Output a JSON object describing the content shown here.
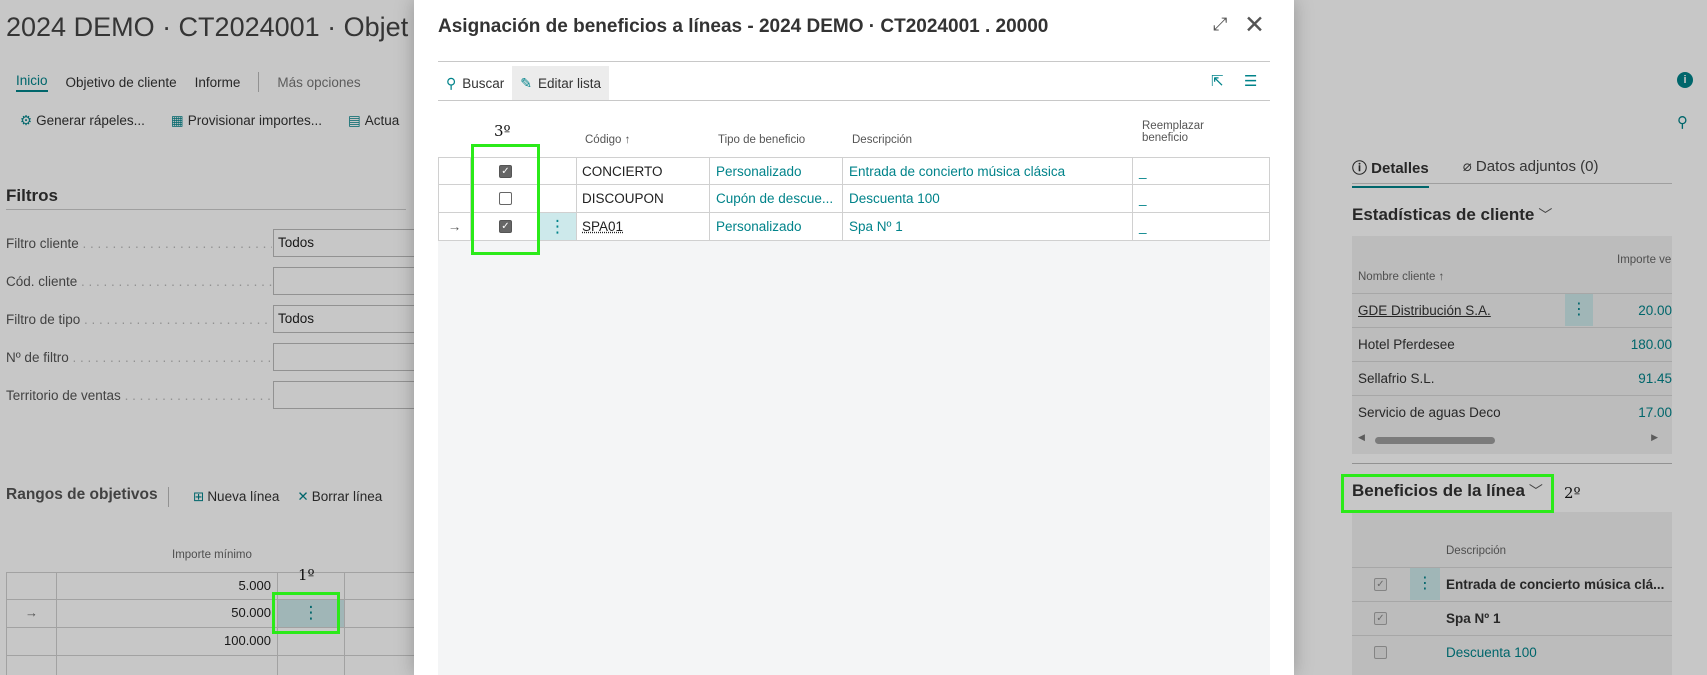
{
  "background": {
    "page_title": "2024 DEMO · CT2024001 · Objet",
    "actions": {
      "inicio": "Inicio",
      "objetivo_cliente": "Objetivo de cliente",
      "informe": "Informe",
      "mas_opciones": "Más opciones"
    },
    "commands": {
      "generar": "Generar rápeles...",
      "provisionar": "Provisionar importes...",
      "actualizar": "Actua"
    },
    "filters": {
      "title": "Filtros",
      "rows": [
        {
          "label": "Filtro cliente",
          "value": "Todos"
        },
        {
          "label": "Cód. cliente",
          "value": ""
        },
        {
          "label": "Filtro de tipo",
          "value": "Todos"
        },
        {
          "label": "Nº de filtro",
          "value": ""
        },
        {
          "label": "Territorio de ventas",
          "value": ""
        }
      ]
    },
    "ranges": {
      "title": "Rangos de objetivos",
      "nueva_linea": "Nueva línea",
      "borrar_linea": "Borrar línea",
      "header_importe": "Importe mínimo",
      "rows": [
        {
          "arrow": "",
          "importe": "5.000"
        },
        {
          "arrow": "→",
          "importe": "50.000"
        },
        {
          "arrow": "",
          "importe": "100.000"
        },
        {
          "arrow": "",
          "importe": ""
        }
      ]
    },
    "factbox": {
      "tab_detalles": "Detalles",
      "tab_adjuntos": "Datos adjuntos (0)",
      "stats_title": "Estadísticas de cliente",
      "header_name": "Nombre cliente ↑",
      "header_amount": "Importe ve",
      "customers": [
        {
          "name": "GDE Distribución S.A.",
          "amount": "20.00"
        },
        {
          "name": "Hotel Pferdesee",
          "amount": "180.00"
        },
        {
          "name": "Sellafrio S.L.",
          "amount": "91.45"
        },
        {
          "name": "Servicio de aguas Deco",
          "amount": "17.00"
        }
      ],
      "benefits_title": "Beneficios de la línea",
      "header_desc": "Descripción",
      "benefits": [
        {
          "checked": "✓",
          "desc": "Entrada de concierto música clá..."
        },
        {
          "checked": "✓",
          "desc": "Spa Nº 1"
        },
        {
          "checked": "",
          "desc": "Descuenta 100"
        }
      ]
    }
  },
  "modal": {
    "title": "Asignación de beneficios a líneas - 2024 DEMO · CT2024001 . 20000",
    "buscar": "Buscar",
    "editar_lista": "Editar lista",
    "headers": {
      "codigo": "Código ↑",
      "tipo": "Tipo de beneficio",
      "descripcion": "Descripción",
      "reemplazar_1": "Reemplazar",
      "reemplazar_2": "beneficio"
    },
    "rows": [
      {
        "arrow": "",
        "checked": "✓",
        "code": "CONCIERTO",
        "type": "Personalizado",
        "desc": "Entrada de concierto música clásica",
        "replace": "_"
      },
      {
        "arrow": "",
        "checked": "",
        "code": "DISCOUPON",
        "type": "Cupón de descue...",
        "desc": "Descuenta 100",
        "replace": "_"
      },
      {
        "arrow": "→",
        "checked": "✓",
        "code": "SPA01",
        "type": "Personalizado",
        "desc": "Spa Nº 1",
        "replace": "_"
      }
    ]
  },
  "annotations": {
    "step1": "1º",
    "step2": "2º",
    "step3": "3º",
    "color": "#2bea19"
  }
}
